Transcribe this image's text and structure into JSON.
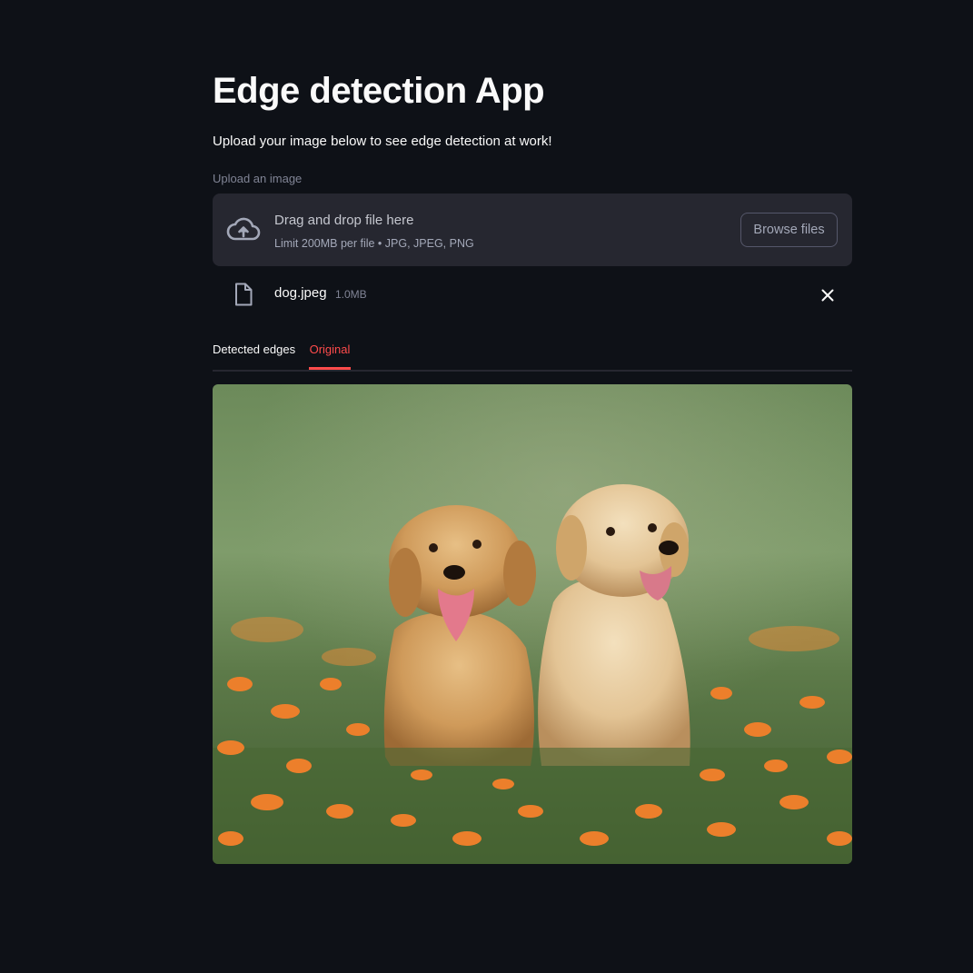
{
  "app": {
    "title": "Edge detection App",
    "subtitle": "Upload your image below to see edge detection at work!"
  },
  "uploader": {
    "label": "Upload an image",
    "drop_text": "Drag and drop file here",
    "limit_text": "Limit 200MB per file • JPG, JPEG, PNG",
    "browse_label": "Browse files",
    "icon": "cloud-upload-icon"
  },
  "file": {
    "name": "dog.jpeg",
    "size": "1.0MB",
    "icon": "file-icon",
    "remove_icon": "close-icon"
  },
  "tabs": [
    {
      "label": "Detected edges",
      "active": false
    },
    {
      "label": "Original",
      "active": true
    }
  ],
  "colors": {
    "background": "#0e1117",
    "panel": "#262730",
    "accent": "#ff4b4b",
    "text": "#fafafa",
    "muted": "#808495"
  },
  "image": {
    "subject": "two golden retriever puppies sitting on grass with orange petals"
  }
}
